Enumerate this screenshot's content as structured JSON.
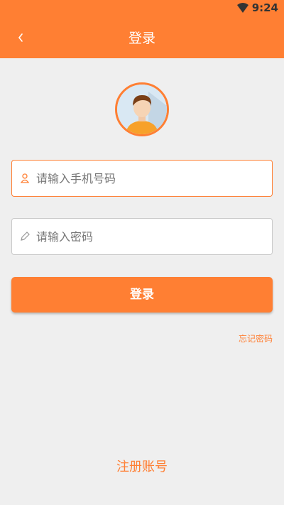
{
  "status_bar": {
    "time": "9:24",
    "wifi_icon": "wifi-icon"
  },
  "header": {
    "title": "登录",
    "back_icon": "chevron-left-icon",
    "color": "#ff7f33"
  },
  "avatar": {
    "icon": "user-avatar-icon"
  },
  "form": {
    "phone": {
      "placeholder": "请输入手机号码",
      "value": "",
      "icon": "user-icon"
    },
    "password": {
      "placeholder": "请输入密码",
      "value": "",
      "icon": "pencil-icon"
    },
    "login_label": "登录",
    "forgot_label": "忘记密码"
  },
  "footer": {
    "register_label": "注册账号"
  },
  "colors": {
    "accent": "#ff7f33",
    "background": "#efefef"
  }
}
